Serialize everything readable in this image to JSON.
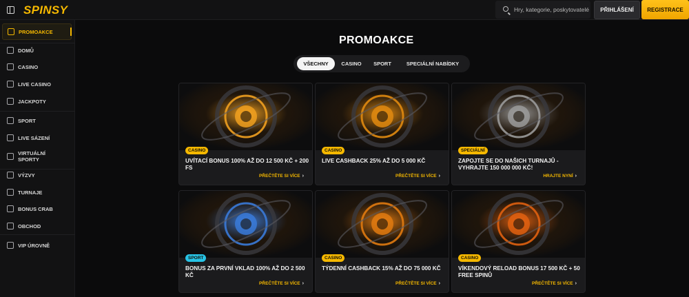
{
  "header": {
    "logo": "SPINSY",
    "search_placeholder": "Hry, kategorie, poskytovatelé",
    "login_label": "PŘIHLÁŠENÍ",
    "register_label": "REGISTRACE"
  },
  "sidebar": {
    "items": [
      {
        "label": "PROMOAKCE",
        "icon": "gift-icon",
        "active": true
      },
      {
        "label": "DOMŮ",
        "icon": "home-icon"
      },
      {
        "label": "CASINO",
        "icon": "casino-icon"
      },
      {
        "label": "LIVE CASINO",
        "icon": "live-casino-icon"
      },
      {
        "label": "JACKPOTY",
        "icon": "jackpot-icon"
      },
      {
        "label": "SPORT",
        "icon": "sport-icon"
      },
      {
        "label": "LIVE SÁZENÍ",
        "icon": "live-betting-icon"
      },
      {
        "label": "VIRTUÁLNÍ SPORTY",
        "icon": "virtual-sports-icon"
      },
      {
        "label": "VÝZVY",
        "icon": "challenges-icon"
      },
      {
        "label": "TURNAJE",
        "icon": "trophy-icon"
      },
      {
        "label": "BONUS CRAB",
        "icon": "crab-icon"
      },
      {
        "label": "OBCHOD",
        "icon": "shop-icon"
      },
      {
        "label": "VIP ÚROVNĚ",
        "icon": "diamond-icon"
      }
    ]
  },
  "main": {
    "title": "PROMOAKCE",
    "tabs": [
      {
        "label": "VŠECHNY",
        "active": true
      },
      {
        "label": "CASINO"
      },
      {
        "label": "SPORT"
      },
      {
        "label": "SPECIÁLNÍ NABÍDKY"
      }
    ],
    "promos": [
      {
        "badge": "CASINO",
        "badge_color": "#f5b800",
        "title": "UVÍTACÍ BONUS 100% AŽ DO 12 500 KČ + 200 FS",
        "link": "PŘEČTĚTE SI VÍCE",
        "art_color": "#f0a020"
      },
      {
        "badge": "CASINO",
        "badge_color": "#f5b800",
        "title": "LIVE CASHBACK 25% AŽ DO 5 000 KČ",
        "link": "PŘEČTĚTE SI VÍCE",
        "art_color": "#e08a10"
      },
      {
        "badge": "SPECIÁLNÍ",
        "badge_color": "#f5b800",
        "title": "ZAPOJTE SE DO NAŠICH TURNAJŮ - VYHRAJTE 150 000 000 KČ!",
        "link": "HRAJTE NYNÍ",
        "art_color": "#9a9a9a"
      },
      {
        "badge": "SPORT",
        "badge_color": "#27c3e6",
        "title": "BONUS ZA PRVNÍ VKLAD 100% AŽ DO 2 500 KČ",
        "link": "PŘEČTĚTE SI VÍCE",
        "art_color": "#3a7ad8"
      },
      {
        "badge": "CASINO",
        "badge_color": "#f5b800",
        "title": "TÝDENNÍ CASHBACK 15% AŽ DO 75 000 KČ",
        "link": "PŘEČTĚTE SI VÍCE",
        "art_color": "#e07a10"
      },
      {
        "badge": "CASINO",
        "badge_color": "#f5b800",
        "title": "VÍKENDOVÝ RELOAD BONUS 17 500 KČ + 50 FREE SPINŮ",
        "link": "PŘEČTĚTE SI VÍCE",
        "art_color": "#e06010"
      }
    ]
  }
}
